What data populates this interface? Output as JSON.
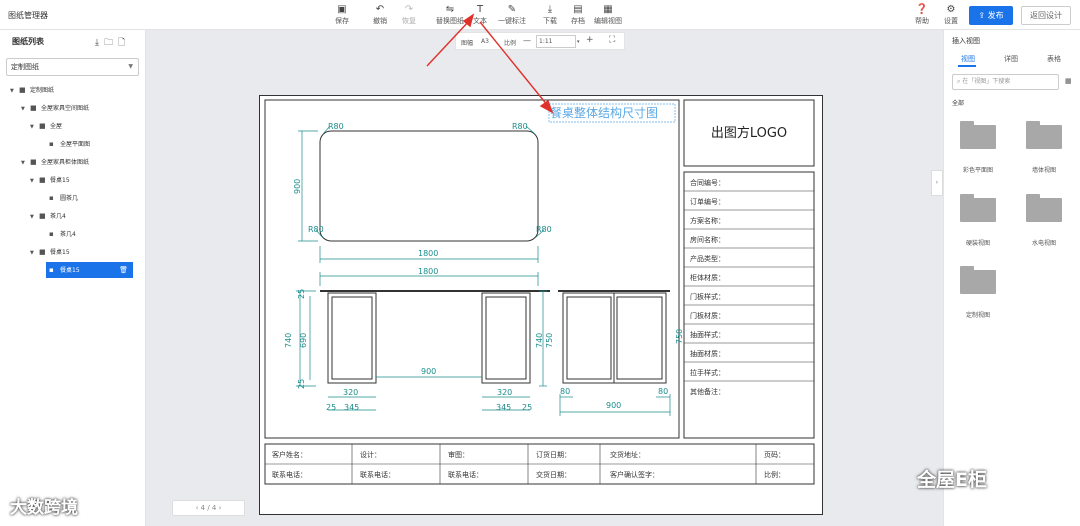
{
  "app": {
    "title": "图纸管理器"
  },
  "toolbar": {
    "save": "保存",
    "undo": "撤销",
    "redo": "恢复",
    "replace": "替换图纸",
    "text": "文本",
    "one_click_dim": "一键标注",
    "download": "下载",
    "save_as": "存档",
    "edit_view": "编辑视图",
    "help": "帮助",
    "settings": "设置",
    "publish": "发布",
    "back": "返回设计"
  },
  "zoom": {
    "paper_label": "图幅",
    "paper_value": "A3",
    "scale_label": "比例",
    "minus": "—",
    "scale_value": "1:11",
    "plus": "+"
  },
  "left_panel": {
    "title": "图纸列表",
    "select_value": "定制图纸",
    "tree": [
      {
        "label": "定制图纸",
        "icon": "folder"
      },
      {
        "label": "全屋家具空间图纸",
        "icon": "folder"
      },
      {
        "label": "全屋",
        "icon": "folder"
      },
      {
        "label": "全屋平面图",
        "icon": "file"
      },
      {
        "label": "全屋家具柜体图纸",
        "icon": "folder"
      },
      {
        "label": "餐桌15",
        "icon": "folder"
      },
      {
        "label": "圆茶几",
        "icon": "file"
      },
      {
        "label": "茶几4",
        "icon": "folder"
      },
      {
        "label": "茶几4",
        "icon": "file"
      },
      {
        "label": "餐桌15",
        "icon": "folder"
      },
      {
        "label": "餐桌15",
        "icon": "file",
        "selected": true
      }
    ]
  },
  "drawing": {
    "title": "餐桌整体结构尺寸图",
    "logo": "出图方LOGO",
    "info_fields": [
      "合同编号：",
      "订单编号：",
      "方案名称：",
      "房间名称：",
      "产品类型：",
      "柜体材质：",
      "门板样式：",
      "门板材质：",
      "抽面样式：",
      "抽面材质：",
      "拉手样式：",
      "其他备注："
    ],
    "footer": {
      "customer_name": "客户姓名：",
      "contact_phone": "联系电话：",
      "design": "设计：",
      "design_phone": "联系电话：",
      "review": "审图：",
      "review_phone": "联系电话：",
      "order_date": "订货日期：",
      "delivery_date": "交货日期：",
      "delivery_address": "交货地址：",
      "customer_sign": "客户确认签字：",
      "page_no": "页码：",
      "scale": "比例："
    },
    "dims": {
      "r_tl": "R80",
      "r_tr": "R80",
      "r_bl": "R80",
      "r_br": "R80",
      "top_h": "900",
      "top_w": "1800",
      "front_w": "1800",
      "d25a": "25",
      "d690": "690",
      "d740a": "740",
      "d25b": "25",
      "d900": "900",
      "d320a": "320",
      "d320b": "320",
      "d25c": "25",
      "d345a": "345",
      "d345b": "345",
      "d25d": "25",
      "d740b": "740",
      "d750a": "750",
      "d750b": "750",
      "d80a": "80",
      "d80b": "80",
      "d900s": "900"
    }
  },
  "pager": {
    "prev": "‹",
    "current": "4",
    "sep": "/",
    "total": "4",
    "next": "›"
  },
  "right_panel": {
    "title": "插入视图",
    "tabs": [
      "视图",
      "详图",
      "表格"
    ],
    "search_placeholder": "在「视图」下搜索",
    "section": "全部",
    "views": [
      "彩色平面图",
      "墙体视图",
      "硬装视图",
      "水电视图",
      "定制视图"
    ]
  },
  "watermarks": {
    "left": "大数跨境",
    "right": "全屋E柜"
  },
  "colors": {
    "accent": "#1a73e8",
    "dimension": "#1a8c8c",
    "title_text": "#5aa9e6",
    "arrow": "#e0302a"
  }
}
